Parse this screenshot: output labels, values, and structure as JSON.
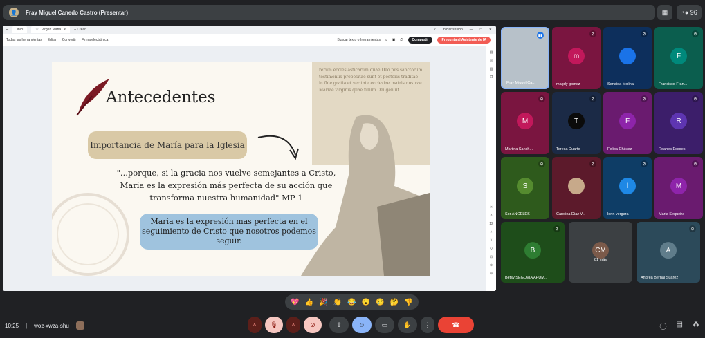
{
  "meeting": {
    "presenter_label": "Fray Miguel Canedo Castro (Presentar)",
    "people_count": "96",
    "time": "10:25",
    "code": "woz-xwza-shu"
  },
  "browser": {
    "tab_home": "Inici",
    "tab_doc": "Virgen Maria",
    "tab_new": "Crear",
    "login": "Iniciar sesión",
    "toolbar": [
      "Todas las herramientas",
      "Editar",
      "Convertir",
      "Firma electrónica"
    ],
    "search": "Buscar texto o herramientas",
    "share": "Compartir",
    "ai": "Pregunta al Asistente de IA",
    "page": "8",
    "pages": "12"
  },
  "slide": {
    "title": "Antecedentes",
    "box1": "Importancia de María para la Iglesia",
    "quote": "\"...porque, si la gracia nos vuelve semejantes a Cristo, María es la expresión más perfecta de su acción que transforma nuestra humanidad\" MP 1",
    "box2": "María es la expresión mas perfecta en el seguimiento de Cristo que nosotros podemos seguir.",
    "paper_text": "rerum ecclesiasticarum quae Deo piis sanctorum testimoniis propositae sunt et posteris traditae in fide gratia et veritate ecclesiae matris nostrae Mariae virginis quae filium Dei genuit"
  },
  "participants": [
    {
      "name": "Fray Miguel Ca...",
      "initial": "",
      "bg": "#b7c1c9",
      "avatar": "",
      "mic": "speaking"
    },
    {
      "name": "magdy gomez",
      "initial": "m",
      "bg": "#7a1540",
      "avatar": "#c2185b",
      "mic": "muted"
    },
    {
      "name": "Senaida Molina",
      "initial": "",
      "bg": "#0d2f5c",
      "avatar": "#1a73e8",
      "mic": "muted"
    },
    {
      "name": "Francisco Fran...",
      "initial": "F",
      "bg": "#0b5e4e",
      "avatar": "#00897b",
      "mic": "muted"
    },
    {
      "name": "Martina Sanch...",
      "initial": "M",
      "bg": "#7a1540",
      "avatar": "#c2185b",
      "mic": "muted"
    },
    {
      "name": "Teresa Duarte",
      "initial": "T",
      "bg": "#1b2a46",
      "avatar": "#0b0b0b",
      "mic": "muted"
    },
    {
      "name": "Felipa Chávez",
      "initial": "F",
      "bg": "#6a1b6f",
      "avatar": "#8e24aa",
      "mic": "muted"
    },
    {
      "name": "Roanes Essoes",
      "initial": "R",
      "bg": "#3c1e6a",
      "avatar": "#5e35b1",
      "mic": "muted"
    },
    {
      "name": "Sor ANGELES",
      "initial": "S",
      "bg": "#2e5a1c",
      "avatar": "#558b2f",
      "mic": "muted"
    },
    {
      "name": "Carolina Diaz V...",
      "initial": "",
      "bg": "#5c1a2b",
      "avatar": "#c7a98a",
      "mic": "muted"
    },
    {
      "name": "lorin vergara",
      "initial": "l",
      "bg": "#0e3d66",
      "avatar": "#1e88e5",
      "mic": "muted"
    },
    {
      "name": "Maria Sequeira",
      "initial": "M",
      "bg": "#6a1b6f",
      "avatar": "#8e24aa",
      "mic": "muted"
    },
    {
      "name": "Betsy SEGOVIA APUM...",
      "initial": "B",
      "bg": "#1e4d1a",
      "avatar": "#2e7d32",
      "mic": "muted"
    },
    {
      "name": "81 más",
      "initial": "CM",
      "bg": "#3c4043",
      "avatar": "#7b5a4a",
      "mic": ""
    },
    {
      "name": "Andrea Bernal Suárez",
      "initial": "A",
      "bg": "#2c4a5a",
      "avatar": "#607d8b",
      "mic": "muted"
    }
  ],
  "reactions": [
    "💖",
    "👍",
    "🎉",
    "👏",
    "😂",
    "😮",
    "😢",
    "🤔",
    "👎"
  ]
}
